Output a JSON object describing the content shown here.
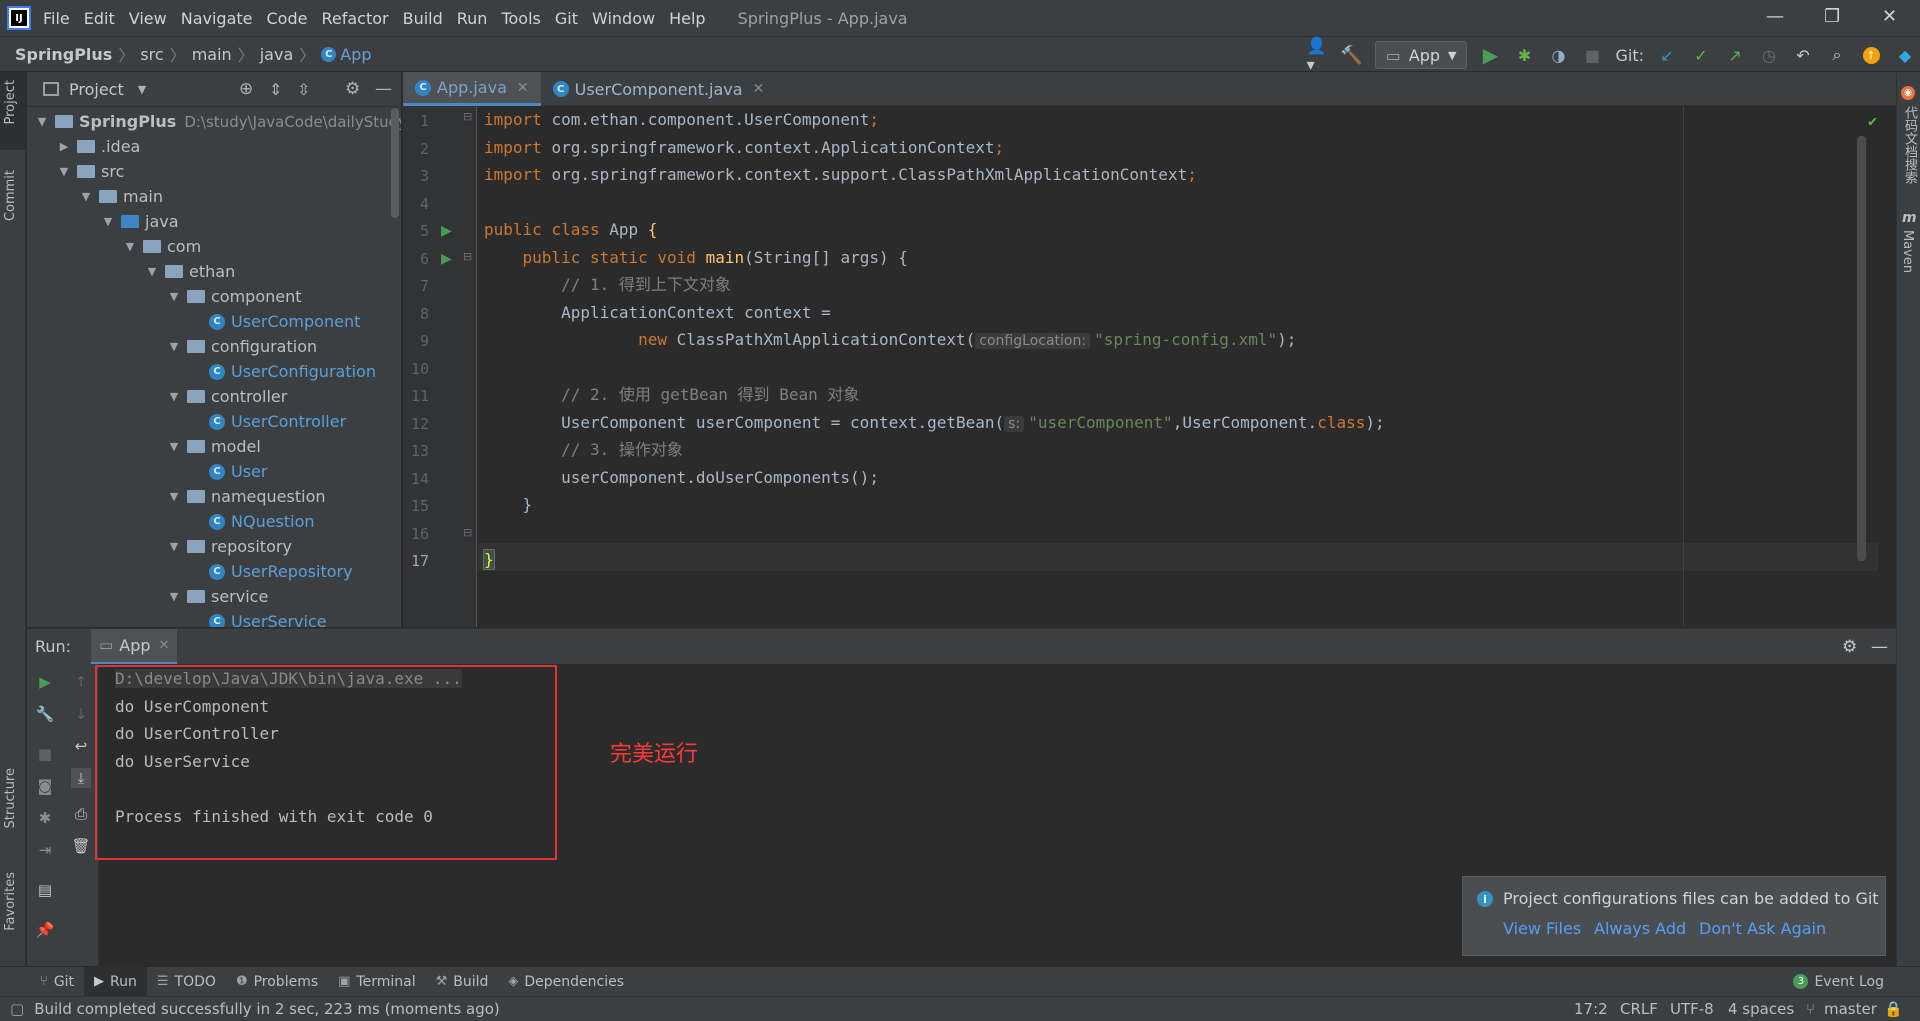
{
  "window": {
    "title": "SpringPlus - App.java",
    "logo_text": "IJ",
    "controls": [
      "—",
      "❐",
      "✕"
    ]
  },
  "menu": [
    "File",
    "Edit",
    "View",
    "Navigate",
    "Code",
    "Refactor",
    "Build",
    "Run",
    "Tools",
    "Git",
    "Window",
    "Help"
  ],
  "breadcrumb": [
    "SpringPlus",
    "src",
    "main",
    "java",
    "App"
  ],
  "toolbar": {
    "run_config": "App",
    "git_label": "Git:"
  },
  "left_stripe": {
    "project": "Project",
    "commit": "Commit",
    "structure": "Structure",
    "favorites": "Favorites"
  },
  "right_stripe": {
    "plugin": "代码文档搜索",
    "maven": "Maven"
  },
  "project_panel": {
    "title": "Project",
    "tree": [
      {
        "label": "SpringPlus",
        "path": "D:\\study\\JavaCode\\dailyStudy\\S",
        "depth": 0,
        "kind": "module"
      },
      {
        "label": ".idea",
        "depth": 1,
        "kind": "folder",
        "collapsed": true
      },
      {
        "label": "src",
        "depth": 1,
        "kind": "folder"
      },
      {
        "label": "main",
        "depth": 2,
        "kind": "folder"
      },
      {
        "label": "java",
        "depth": 3,
        "kind": "source"
      },
      {
        "label": "com",
        "depth": 4,
        "kind": "package"
      },
      {
        "label": "ethan",
        "depth": 5,
        "kind": "package"
      },
      {
        "label": "component",
        "depth": 6,
        "kind": "package"
      },
      {
        "label": "UserComponent",
        "depth": 7,
        "kind": "class"
      },
      {
        "label": "configuration",
        "depth": 6,
        "kind": "package"
      },
      {
        "label": "UserConfiguration",
        "depth": 7,
        "kind": "class"
      },
      {
        "label": "controller",
        "depth": 6,
        "kind": "package"
      },
      {
        "label": "UserController",
        "depth": 7,
        "kind": "class"
      },
      {
        "label": "model",
        "depth": 6,
        "kind": "package"
      },
      {
        "label": "User",
        "depth": 7,
        "kind": "class"
      },
      {
        "label": "namequestion",
        "depth": 6,
        "kind": "package"
      },
      {
        "label": "NQuestion",
        "depth": 7,
        "kind": "class"
      },
      {
        "label": "repository",
        "depth": 6,
        "kind": "package"
      },
      {
        "label": "UserRepository",
        "depth": 7,
        "kind": "class"
      },
      {
        "label": "service",
        "depth": 6,
        "kind": "package"
      },
      {
        "label": "UserService",
        "depth": 7,
        "kind": "class"
      }
    ]
  },
  "editor": {
    "tabs": [
      {
        "label": "App.java",
        "active": true
      },
      {
        "label": "UserComponent.java",
        "active": false
      }
    ],
    "cursor_line": 17,
    "lines": {
      "l1": "com.ethan.component.UserComponent",
      "l2": "org.springframework.context.ApplicationContext",
      "l3": "org.springframework.context.support.ClassPathXmlApplicationContext",
      "kw_import": "import",
      "kw_public": "public",
      "kw_class": "class",
      "kw_static": "static",
      "kw_void": "void",
      "kw_new": "new",
      "kw_class_lit": "class",
      "class_name": "App",
      "main_fn": "main",
      "main_args": "(String[] args) ",
      "c1": "// 1. 得到上下文对象",
      "l8": "ApplicationContext context =",
      "l9_call": "ClassPathXmlApplicationContext(",
      "hint_config": "configLocation:",
      "str_config": "\"spring-config.xml\"",
      "c2": "// 2. 使用 getBean 得到 Bean 对象",
      "l12a": "UserComponent userComponent = context.getBean(",
      "hint_s": "s:",
      "str_user": "\"userComponent\"",
      "l12b": ",UserComponent.",
      "c3": "// 3. 操作对象",
      "l15": "userComponent.doUserComponents();"
    }
  },
  "run_panel": {
    "label": "Run:",
    "tab": "App",
    "console": [
      "D:\\develop\\Java\\JDK\\bin\\java.exe ...",
      "do UserComponent",
      "do UserController",
      "do UserService",
      "",
      "Process finished with exit code 0"
    ],
    "annotation": "完美运行"
  },
  "notification": {
    "message": "Project configurations files can be added to Git",
    "actions": [
      "View Files",
      "Always Add",
      "Don't Ask Again"
    ]
  },
  "bottom_tools": [
    "Git",
    "Run",
    "TODO",
    "Problems",
    "Terminal",
    "Build",
    "Dependencies"
  ],
  "event_log": {
    "label": "Event Log",
    "count": "3"
  },
  "status": {
    "message": "Build completed successfully in 2 sec, 223 ms (moments ago)",
    "position": "17:2",
    "line_sep": "CRLF",
    "encoding": "UTF-8",
    "indent": "4 spaces",
    "branch": "master"
  },
  "colors": {
    "accent": "#4a88c7",
    "run_green": "#499c54",
    "annotation_red": "#ff3838"
  }
}
